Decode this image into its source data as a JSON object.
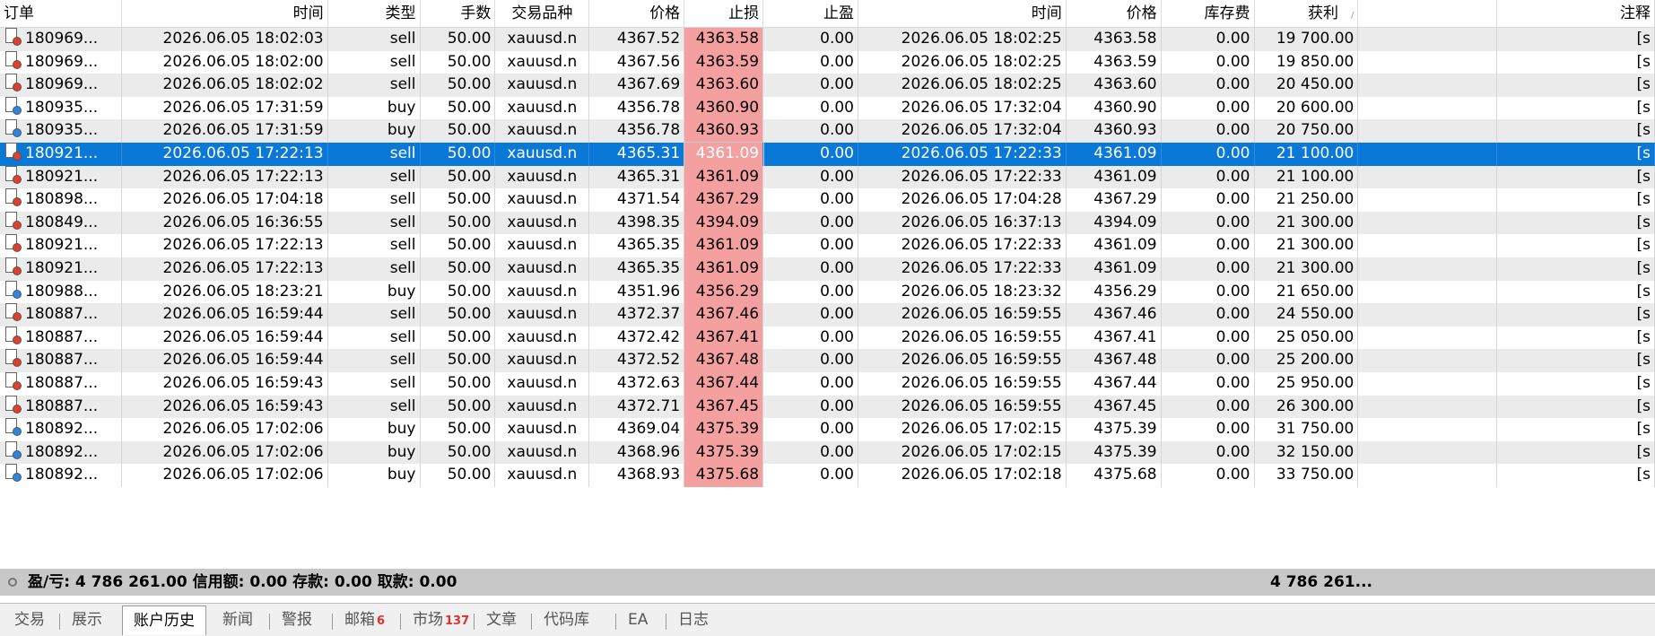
{
  "columns": [
    {
      "label": "订单"
    },
    {
      "label": "时间"
    },
    {
      "label": "类型"
    },
    {
      "label": "手数"
    },
    {
      "label": "交易品种"
    },
    {
      "label": "价格"
    },
    {
      "label": "止损"
    },
    {
      "label": "止盈"
    },
    {
      "label": "时间"
    },
    {
      "label": "价格"
    },
    {
      "label": "库存费"
    },
    {
      "label": "获利"
    },
    {
      "label": ""
    },
    {
      "label": "注释"
    }
  ],
  "sort_indicator": "/",
  "rows": [
    {
      "order": "180969...",
      "open_time": "2026.06.05 18:02:03",
      "type": "sell",
      "volume": "50.00",
      "symbol": "xauusd.n",
      "price": "4367.52",
      "sl": "4363.58",
      "tp": "0.00",
      "close_time": "2026.06.05 18:02:25",
      "close_price": "4363.58",
      "swap": "0.00",
      "profit": "19 700.00",
      "comment": "[s"
    },
    {
      "order": "180969...",
      "open_time": "2026.06.05 18:02:00",
      "type": "sell",
      "volume": "50.00",
      "symbol": "xauusd.n",
      "price": "4367.56",
      "sl": "4363.59",
      "tp": "0.00",
      "close_time": "2026.06.05 18:02:25",
      "close_price": "4363.59",
      "swap": "0.00",
      "profit": "19 850.00",
      "comment": "[s"
    },
    {
      "order": "180969...",
      "open_time": "2026.06.05 18:02:02",
      "type": "sell",
      "volume": "50.00",
      "symbol": "xauusd.n",
      "price": "4367.69",
      "sl": "4363.60",
      "tp": "0.00",
      "close_time": "2026.06.05 18:02:25",
      "close_price": "4363.60",
      "swap": "0.00",
      "profit": "20 450.00",
      "comment": "[s"
    },
    {
      "order": "180935...",
      "open_time": "2026.06.05 17:31:59",
      "type": "buy",
      "volume": "50.00",
      "symbol": "xauusd.n",
      "price": "4356.78",
      "sl": "4360.90",
      "tp": "0.00",
      "close_time": "2026.06.05 17:32:04",
      "close_price": "4360.90",
      "swap": "0.00",
      "profit": "20 600.00",
      "comment": "[s"
    },
    {
      "order": "180935...",
      "open_time": "2026.06.05 17:31:59",
      "type": "buy",
      "volume": "50.00",
      "symbol": "xauusd.n",
      "price": "4356.78",
      "sl": "4360.93",
      "tp": "0.00",
      "close_time": "2026.06.05 17:32:04",
      "close_price": "4360.93",
      "swap": "0.00",
      "profit": "20 750.00",
      "comment": "[s"
    },
    {
      "order": "180921...",
      "open_time": "2026.06.05 17:22:13",
      "type": "sell",
      "volume": "50.00",
      "symbol": "xauusd.n",
      "price": "4365.31",
      "sl": "4361.09",
      "tp": "0.00",
      "close_time": "2026.06.05 17:22:33",
      "close_price": "4361.09",
      "swap": "0.00",
      "profit": "21 100.00",
      "comment": "[s",
      "selected": true
    },
    {
      "order": "180921...",
      "open_time": "2026.06.05 17:22:13",
      "type": "sell",
      "volume": "50.00",
      "symbol": "xauusd.n",
      "price": "4365.31",
      "sl": "4361.09",
      "tp": "0.00",
      "close_time": "2026.06.05 17:22:33",
      "close_price": "4361.09",
      "swap": "0.00",
      "profit": "21 100.00",
      "comment": "[s"
    },
    {
      "order": "180898...",
      "open_time": "2026.06.05 17:04:18",
      "type": "sell",
      "volume": "50.00",
      "symbol": "xauusd.n",
      "price": "4371.54",
      "sl": "4367.29",
      "tp": "0.00",
      "close_time": "2026.06.05 17:04:28",
      "close_price": "4367.29",
      "swap": "0.00",
      "profit": "21 250.00",
      "comment": "[s"
    },
    {
      "order": "180849...",
      "open_time": "2026.06.05 16:36:55",
      "type": "sell",
      "volume": "50.00",
      "symbol": "xauusd.n",
      "price": "4398.35",
      "sl": "4394.09",
      "tp": "0.00",
      "close_time": "2026.06.05 16:37:13",
      "close_price": "4394.09",
      "swap": "0.00",
      "profit": "21 300.00",
      "comment": "[s"
    },
    {
      "order": "180921...",
      "open_time": "2026.06.05 17:22:13",
      "type": "sell",
      "volume": "50.00",
      "symbol": "xauusd.n",
      "price": "4365.35",
      "sl": "4361.09",
      "tp": "0.00",
      "close_time": "2026.06.05 17:22:33",
      "close_price": "4361.09",
      "swap": "0.00",
      "profit": "21 300.00",
      "comment": "[s"
    },
    {
      "order": "180921...",
      "open_time": "2026.06.05 17:22:13",
      "type": "sell",
      "volume": "50.00",
      "symbol": "xauusd.n",
      "price": "4365.35",
      "sl": "4361.09",
      "tp": "0.00",
      "close_time": "2026.06.05 17:22:33",
      "close_price": "4361.09",
      "swap": "0.00",
      "profit": "21 300.00",
      "comment": "[s"
    },
    {
      "order": "180988...",
      "open_time": "2026.06.05 18:23:21",
      "type": "buy",
      "volume": "50.00",
      "symbol": "xauusd.n",
      "price": "4351.96",
      "sl": "4356.29",
      "tp": "0.00",
      "close_time": "2026.06.05 18:23:32",
      "close_price": "4356.29",
      "swap": "0.00",
      "profit": "21 650.00",
      "comment": "[s"
    },
    {
      "order": "180887...",
      "open_time": "2026.06.05 16:59:44",
      "type": "sell",
      "volume": "50.00",
      "symbol": "xauusd.n",
      "price": "4372.37",
      "sl": "4367.46",
      "tp": "0.00",
      "close_time": "2026.06.05 16:59:55",
      "close_price": "4367.46",
      "swap": "0.00",
      "profit": "24 550.00",
      "comment": "[s"
    },
    {
      "order": "180887...",
      "open_time": "2026.06.05 16:59:44",
      "type": "sell",
      "volume": "50.00",
      "symbol": "xauusd.n",
      "price": "4372.42",
      "sl": "4367.41",
      "tp": "0.00",
      "close_time": "2026.06.05 16:59:55",
      "close_price": "4367.41",
      "swap": "0.00",
      "profit": "25 050.00",
      "comment": "[s"
    },
    {
      "order": "180887...",
      "open_time": "2026.06.05 16:59:44",
      "type": "sell",
      "volume": "50.00",
      "symbol": "xauusd.n",
      "price": "4372.52",
      "sl": "4367.48",
      "tp": "0.00",
      "close_time": "2026.06.05 16:59:55",
      "close_price": "4367.48",
      "swap": "0.00",
      "profit": "25 200.00",
      "comment": "[s"
    },
    {
      "order": "180887...",
      "open_time": "2026.06.05 16:59:43",
      "type": "sell",
      "volume": "50.00",
      "symbol": "xauusd.n",
      "price": "4372.63",
      "sl": "4367.44",
      "tp": "0.00",
      "close_time": "2026.06.05 16:59:55",
      "close_price": "4367.44",
      "swap": "0.00",
      "profit": "25 950.00",
      "comment": "[s"
    },
    {
      "order": "180887...",
      "open_time": "2026.06.05 16:59:43",
      "type": "sell",
      "volume": "50.00",
      "symbol": "xauusd.n",
      "price": "4372.71",
      "sl": "4367.45",
      "tp": "0.00",
      "close_time": "2026.06.05 16:59:55",
      "close_price": "4367.45",
      "swap": "0.00",
      "profit": "26 300.00",
      "comment": "[s"
    },
    {
      "order": "180892...",
      "open_time": "2026.06.05 17:02:06",
      "type": "buy",
      "volume": "50.00",
      "symbol": "xauusd.n",
      "price": "4369.04",
      "sl": "4375.39",
      "tp": "0.00",
      "close_time": "2026.06.05 17:02:15",
      "close_price": "4375.39",
      "swap": "0.00",
      "profit": "31 750.00",
      "comment": "[s"
    },
    {
      "order": "180892...",
      "open_time": "2026.06.05 17:02:06",
      "type": "buy",
      "volume": "50.00",
      "symbol": "xauusd.n",
      "price": "4368.96",
      "sl": "4375.39",
      "tp": "0.00",
      "close_time": "2026.06.05 17:02:15",
      "close_price": "4375.39",
      "swap": "0.00",
      "profit": "32 150.00",
      "comment": "[s"
    },
    {
      "order": "180892...",
      "open_time": "2026.06.05 17:02:06",
      "type": "buy",
      "volume": "50.00",
      "symbol": "xauusd.n",
      "price": "4368.93",
      "sl": "4375.68",
      "tp": "0.00",
      "close_time": "2026.06.05 17:02:18",
      "close_price": "4375.68",
      "swap": "0.00",
      "profit": "33 750.00",
      "comment": "[s"
    }
  ],
  "summary": {
    "text": "盈/亏: 4 786 261.00  信用额: 0.00  存款: 0.00  取款: 0.00",
    "profit_total": "4 786 261..."
  },
  "tabs": [
    {
      "label": "交易"
    },
    {
      "label": "展示"
    },
    {
      "label": "账户历史",
      "active": true
    },
    {
      "label": "新闻"
    },
    {
      "label": "警报"
    },
    {
      "label": "邮箱",
      "badge": "6"
    },
    {
      "label": "市场",
      "badge": "137"
    },
    {
      "label": "文章"
    },
    {
      "label": "代码库"
    },
    {
      "label": "EA"
    },
    {
      "label": "日志"
    }
  ],
  "colors": {
    "selected_row": "#0a78d7",
    "stop_loss_bg": "#f5a0a0",
    "sell_dot": "#e0402a",
    "buy_dot": "#2a86e0"
  }
}
